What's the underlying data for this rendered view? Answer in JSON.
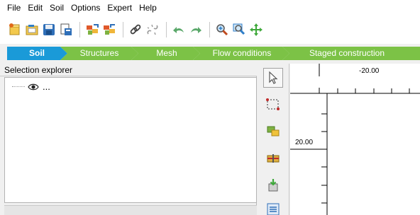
{
  "menu": [
    "File",
    "Edit",
    "Soil",
    "Options",
    "Expert",
    "Help"
  ],
  "toolbar_icons": [
    "new-project-icon",
    "open-project-icon",
    "save-project-icon",
    "project-properties-icon",
    "import-geometry-icon",
    "export-geometry-icon",
    "connect-icon",
    "disconnect-icon",
    "undo-icon",
    "redo-icon",
    "zoom-in-icon",
    "zoom-window-icon",
    "pan-icon"
  ],
  "modes": {
    "soil": "Soil",
    "structures": "Structures",
    "mesh": "Mesh",
    "flow": "Flow conditions",
    "staged": "Staged construction"
  },
  "explorer": {
    "title": "Selection explorer",
    "item_label": "..."
  },
  "canvas": {
    "x_tick_label": "-20.00",
    "y_tick_label": "20.00"
  },
  "colors": {
    "active_mode": "#1a9ad8",
    "inactive_mode": "#7cc246"
  }
}
